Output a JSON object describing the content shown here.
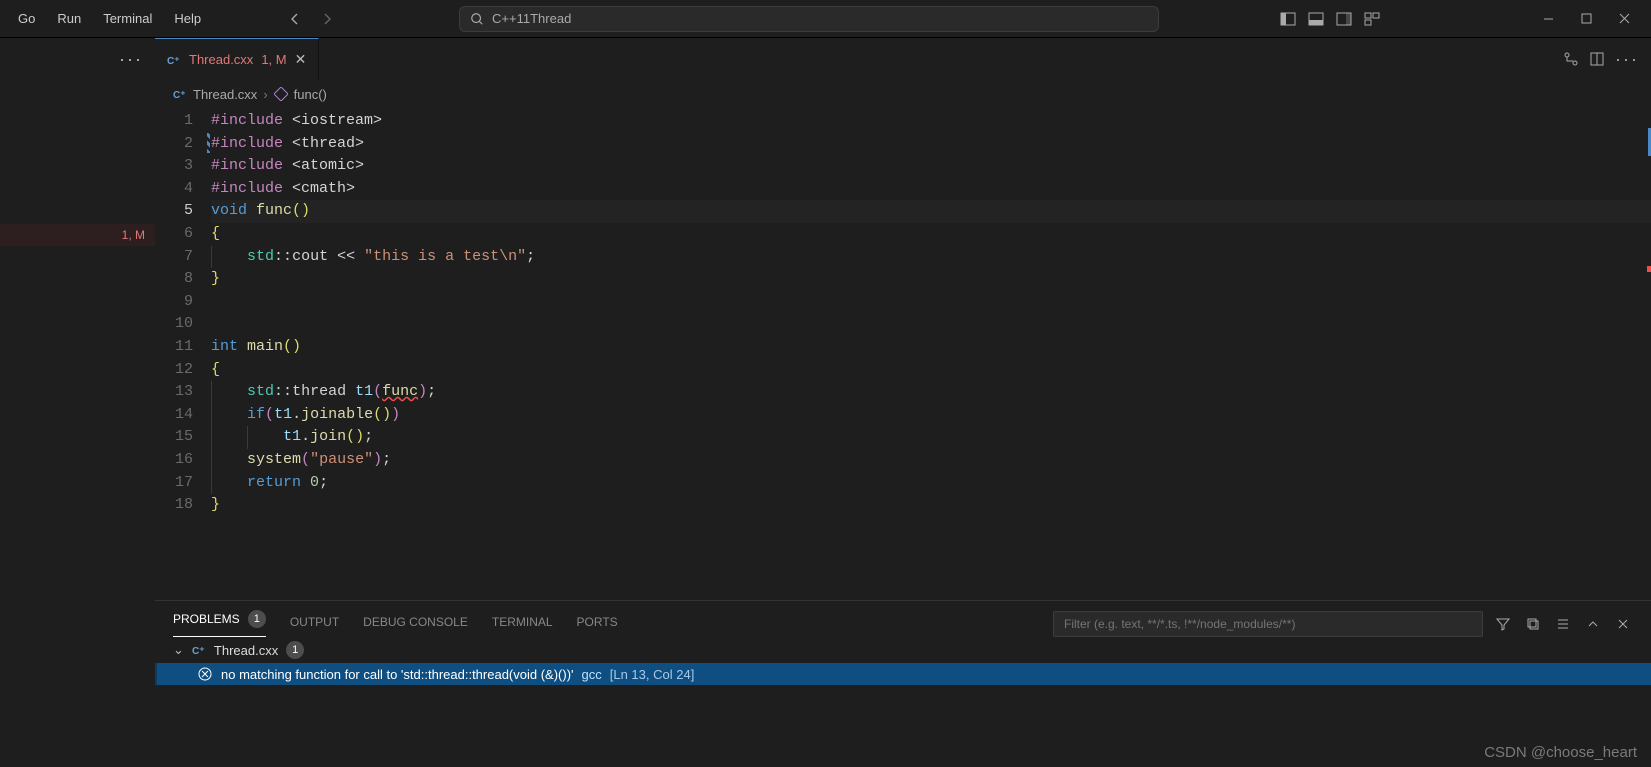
{
  "menu": {
    "go": "Go",
    "run": "Run",
    "terminal": "Terminal",
    "help": "Help"
  },
  "search": {
    "text": "C++11Thread"
  },
  "tab": {
    "filename": "Thread.cxx",
    "badge": "1, M"
  },
  "sidebar": {
    "badge": "1, M"
  },
  "breadcrumb": {
    "file": "Thread.cxx",
    "symbol": "func()"
  },
  "code": {
    "lines": [
      {
        "n": 1,
        "seg": [
          [
            "pp",
            "#include "
          ],
          [
            "op",
            "<"
          ],
          [
            "op",
            "iostream"
          ],
          [
            "op",
            ">"
          ]
        ]
      },
      {
        "n": 2,
        "seg": [
          [
            "pp",
            "#include "
          ],
          [
            "op",
            "<"
          ],
          [
            "op",
            "thread"
          ],
          [
            "op",
            ">"
          ]
        ]
      },
      {
        "n": 3,
        "seg": [
          [
            "pp",
            "#include "
          ],
          [
            "op",
            "<"
          ],
          [
            "op",
            "atomic"
          ],
          [
            "op",
            ">"
          ]
        ]
      },
      {
        "n": 4,
        "seg": [
          [
            "pp",
            "#include "
          ],
          [
            "op",
            "<"
          ],
          [
            "op",
            "cmath"
          ],
          [
            "op",
            ">"
          ]
        ]
      },
      {
        "n": 5,
        "cur": true,
        "seg": [
          [
            "kw",
            "void "
          ],
          [
            "fn",
            "func"
          ],
          [
            "br",
            "("
          ],
          [
            "br",
            ")"
          ]
        ]
      },
      {
        "n": 6,
        "seg": [
          [
            "br",
            "{"
          ]
        ]
      },
      {
        "n": 7,
        "indent": 1,
        "seg": [
          [
            "ns",
            "std"
          ],
          [
            "op",
            "::"
          ],
          [
            "op",
            "cout "
          ],
          [
            "op",
            "<< "
          ],
          [
            "str",
            "\"this is a test\\n\""
          ],
          [
            "op",
            ";"
          ]
        ]
      },
      {
        "n": 8,
        "seg": [
          [
            "br",
            "}"
          ]
        ]
      },
      {
        "n": 9,
        "seg": []
      },
      {
        "n": 10,
        "seg": []
      },
      {
        "n": 11,
        "seg": [
          [
            "kw",
            "int "
          ],
          [
            "fn",
            "main"
          ],
          [
            "br",
            "("
          ],
          [
            "br",
            ")"
          ]
        ]
      },
      {
        "n": 12,
        "seg": [
          [
            "br",
            "{"
          ]
        ]
      },
      {
        "n": 13,
        "indent": 1,
        "seg": [
          [
            "ns",
            "std"
          ],
          [
            "op",
            "::"
          ],
          [
            "op",
            "thread "
          ],
          [
            "var",
            "t1"
          ],
          [
            "br2",
            "("
          ],
          [
            "fnerr",
            "func"
          ],
          [
            "br2",
            ")"
          ],
          [
            "op",
            ";"
          ]
        ]
      },
      {
        "n": 14,
        "indent": 1,
        "seg": [
          [
            "kw",
            "if"
          ],
          [
            "br2",
            "("
          ],
          [
            "var",
            "t1"
          ],
          [
            "op",
            "."
          ],
          [
            "fn",
            "joinable"
          ],
          [
            "br",
            "("
          ],
          [
            "br",
            ")"
          ],
          [
            "br2",
            ")"
          ]
        ]
      },
      {
        "n": 15,
        "indent": 2,
        "seg": [
          [
            "var",
            "t1"
          ],
          [
            "op",
            "."
          ],
          [
            "fn",
            "join"
          ],
          [
            "br",
            "("
          ],
          [
            "br",
            ")"
          ],
          [
            "op",
            ";"
          ]
        ]
      },
      {
        "n": 16,
        "indent": 1,
        "seg": [
          [
            "fn",
            "system"
          ],
          [
            "br2",
            "("
          ],
          [
            "str",
            "\"pause\""
          ],
          [
            "br2",
            ")"
          ],
          [
            "op",
            ";"
          ]
        ]
      },
      {
        "n": 17,
        "indent": 1,
        "seg": [
          [
            "kw",
            "return "
          ],
          [
            "num",
            "0"
          ],
          [
            "op",
            ";"
          ]
        ]
      },
      {
        "n": 18,
        "seg": [
          [
            "br",
            "}"
          ]
        ]
      }
    ]
  },
  "panel": {
    "tabs": {
      "problems": "PROBLEMS",
      "output": "OUTPUT",
      "debug": "DEBUG CONSOLE",
      "terminal": "TERMINAL",
      "ports": "PORTS"
    },
    "problems_count": "1",
    "filter_placeholder": "Filter (e.g. text, **/*.ts, !**/node_modules/**)",
    "file": "Thread.cxx",
    "file_count": "1",
    "error_msg": "no matching function for call to 'std::thread::thread(void (&)())'",
    "error_source": "gcc",
    "error_loc": "[Ln 13, Col 24]"
  },
  "watermark": "CSDN @choose_heart"
}
